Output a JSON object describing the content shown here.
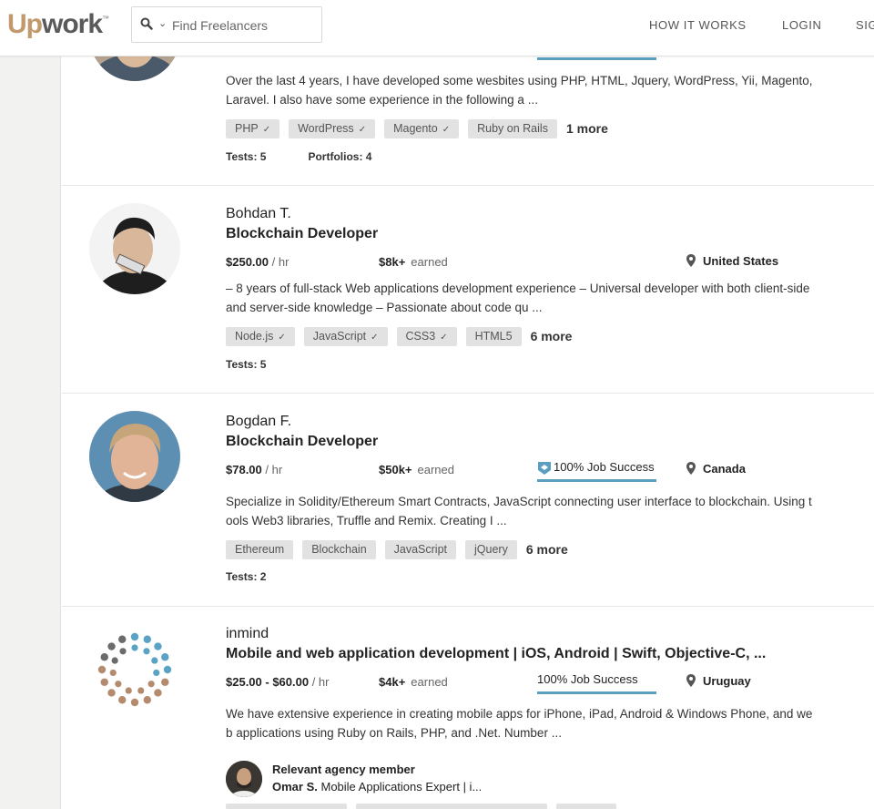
{
  "header": {
    "logo_up": "Up",
    "logo_work": "work",
    "logo_tm": "™",
    "search": {
      "placeholder": "Find Freelancers"
    },
    "nav": [
      "HOW IT WORKS",
      "LOGIN",
      "SIGN UP"
    ]
  },
  "freelancers": [
    {
      "description": "Over the last 4 years, I have developed some wesbites using PHP, HTML, Jquery, WordPress, Yii, Magento, Laravel. I also have some experience in the following a ...",
      "skills": [
        "PHP",
        "WordPress",
        "Magento",
        "Ruby on Rails"
      ],
      "more": "1 more",
      "tests": "Tests: 5",
      "portfolios": "Portfolios: 4"
    },
    {
      "name": "Bohdan T.",
      "title": "Blockchain Developer",
      "rate": "$250.00",
      "rate_unit": "/ hr",
      "earned": "$8k+",
      "earned_label": "earned",
      "location": "United States",
      "description": "– 8 years of full-stack Web applications development experience – Universal developer with both client-side and server-side knowledge – Passionate about code qu ...",
      "skills": [
        "Node.js",
        "JavaScript",
        "CSS3",
        "HTML5"
      ],
      "more": "6 more",
      "tests": "Tests: 5"
    },
    {
      "name": "Bogdan F.",
      "title": "Blockchain Developer",
      "rate": "$78.00",
      "rate_unit": "/ hr",
      "earned": "$50k+",
      "earned_label": "earned",
      "job_success": "100% Job Success",
      "location": "Canada",
      "description": "Specialize in Solidity/Ethereum Smart Contracts, JavaScript connecting user interface to blockchain. Using tools Web3 libraries, Truffle and Remix. Creating I ...",
      "skills": [
        "Ethereum",
        "Blockchain",
        "JavaScript",
        "jQuery"
      ],
      "more": "6 more",
      "tests": "Tests: 2"
    },
    {
      "name": "inmind",
      "title": "Mobile and web application development | iOS, Android | Swift, Objective-C, ...",
      "rate": "$25.00 - $60.00",
      "rate_unit": "/ hr",
      "earned": "$4k+",
      "earned_label": "earned",
      "job_success": "100% Job Success",
      "location": "Uruguay",
      "description": "We have extensive experience in creating mobile apps for iPhone, iPad, Android & Windows Phone, and web applications using Ruby on Rails, PHP, and .Net. Number ...",
      "agency_label": "Relevant agency member",
      "agency_member_name": "Omar S.",
      "agency_member_title": "Mobile Applications Expert | i..."
    }
  ],
  "colors": {
    "brand_up": "#c1996b",
    "job_success_bar": "#5a9fc0",
    "tag_bg": "#e2e2e2"
  }
}
